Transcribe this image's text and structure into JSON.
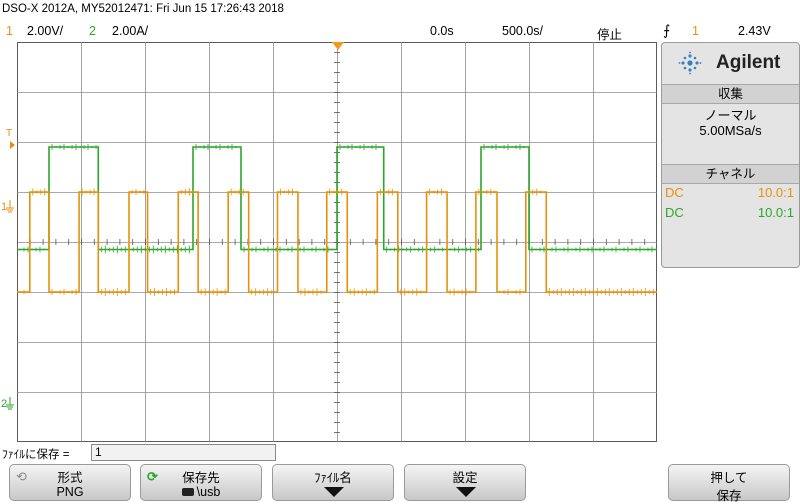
{
  "header": {
    "title": "DSO-X 2012A, MY52012471: Fri Jun 15 17:26:43 2018",
    "ch1_number": "1",
    "ch1_scale": "2.00V/",
    "ch2_number": "2",
    "ch2_scale": "2.00A/",
    "time_delay": "0.0s",
    "time_scale": "500.0s/",
    "run_state": "停止",
    "trigger_icon": "rising-edge-trigger-icon",
    "trigger_source": "1",
    "trigger_level": "2.43V"
  },
  "markers": {
    "trigger_marker": "T",
    "ch1_ground": "1",
    "ch2_ground": "2"
  },
  "colors": {
    "ch1": "#e8900a",
    "ch2": "#2aa62a",
    "grid": "#8c8c8c",
    "trigger_marker": "#f39a1d"
  },
  "panel": {
    "brand": "Agilent",
    "acquisition_header": "収集",
    "acquisition_mode": "ノーマル",
    "sample_rate": "5.00MSa/s",
    "channel_header": "チャネル",
    "ch1_coupling": "DC",
    "ch1_probe": "10.0:1",
    "ch2_coupling": "DC",
    "ch2_probe": "10.0:1"
  },
  "save": {
    "file_label": "ﾌｧｲﾙに保存 =",
    "file_value": "1"
  },
  "softkeys": {
    "format_label": "形式",
    "format_value": "PNG",
    "format_icon": "refresh-icon",
    "location_label": "保存先",
    "location_value": "\\usb",
    "location_icon": "refresh-icon",
    "filename_label": "ﾌｧｲﾙ名",
    "settings_label": "設定",
    "press_label": "押して",
    "save_label": "保存"
  },
  "waveforms": {
    "ch1": {
      "type": "square",
      "high_div": 1.0,
      "low_div": -1.0,
      "edges_div": [
        0.2,
        0.5,
        0.97,
        1.27,
        1.75,
        2.04,
        2.52,
        2.83,
        3.3,
        3.62,
        4.07,
        4.39,
        4.84,
        5.16,
        5.63,
        5.95,
        6.4,
        6.72,
        7.17,
        7.5,
        7.95,
        8.27
      ]
    },
    "ch2": {
      "type": "square",
      "high_div": 1.9,
      "low_div": -0.15,
      "edges_div": [
        0.5,
        1.27,
        2.75,
        3.5,
        5.0,
        5.73,
        7.25,
        8.0
      ]
    }
  }
}
